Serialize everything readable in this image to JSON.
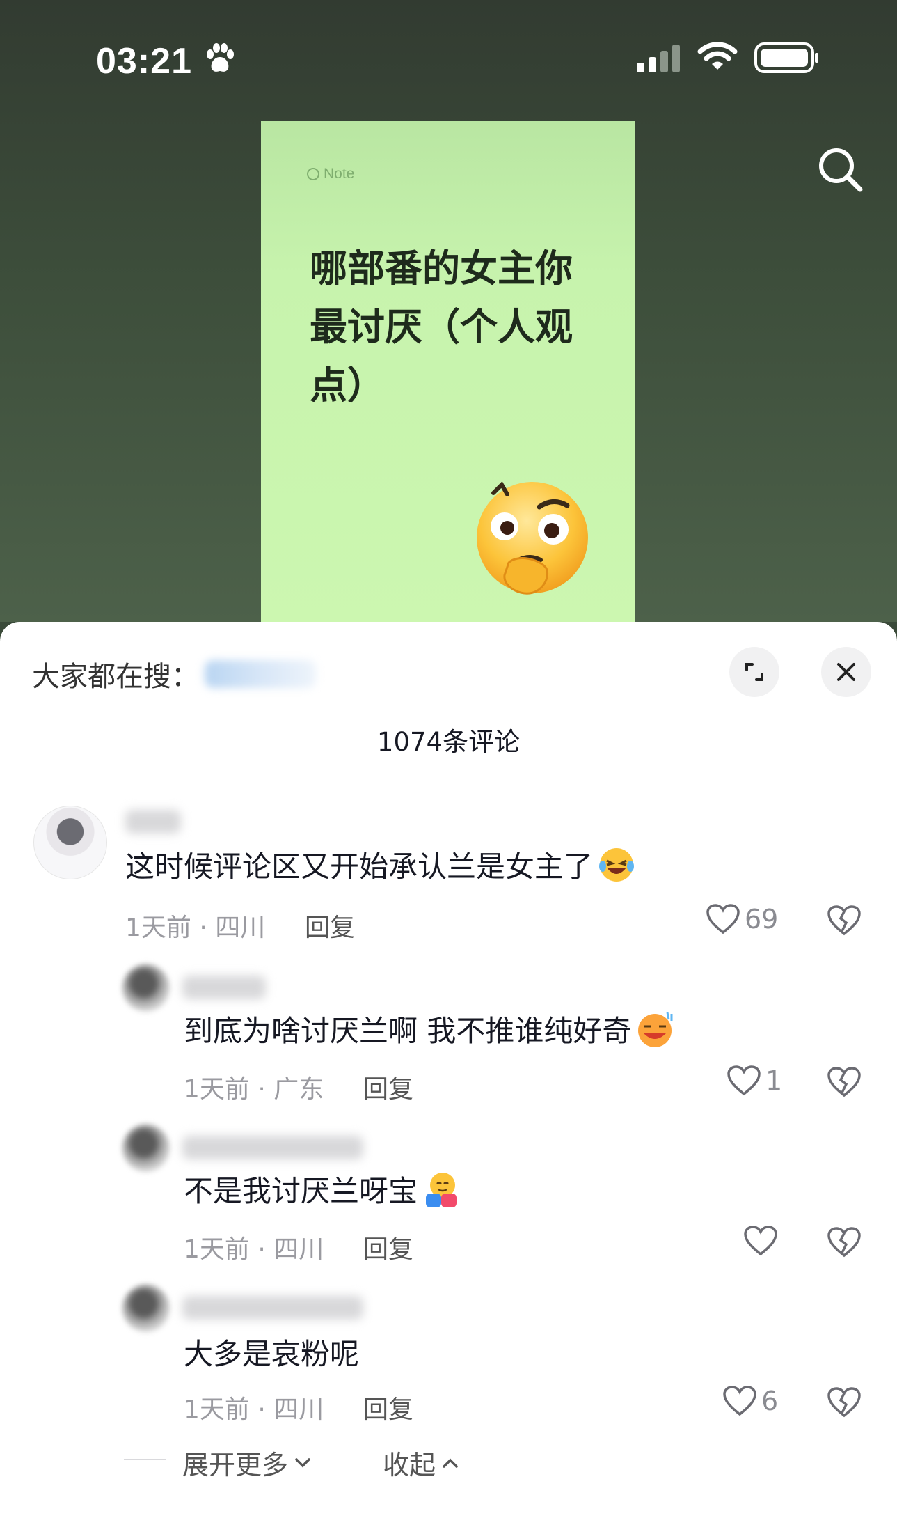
{
  "status_bar": {
    "time": "03:21"
  },
  "note": {
    "tag": "Note",
    "title": "哪部番的女主你最讨厌（个人观点）"
  },
  "sheet": {
    "trending_label": "大家都在搜：",
    "comment_count": "1074条评论"
  },
  "comments": [
    {
      "text": "这时候评论区又开始承认兰是女主了",
      "emoji": "laughing-tears",
      "meta": "1天前 · 四川",
      "reply": "回复",
      "likes": "69"
    },
    {
      "text": "到底为啥讨厌兰啊 我不推谁纯好奇",
      "emoji": "sweat-smile",
      "meta": "1天前 · 广东",
      "reply": "回复",
      "likes": "1"
    },
    {
      "text": "不是我讨厌兰呀宝",
      "emoji": "hug",
      "meta": "1天前 · 四川",
      "reply": "回复",
      "likes": ""
    },
    {
      "text": "大多是哀粉呢",
      "emoji": "",
      "meta": "1天前 · 四川",
      "reply": "回复",
      "likes": "6"
    }
  ],
  "footer": {
    "expand_more": "展开更多",
    "collapse": "收起"
  },
  "colors": {
    "note_bg": "#ccf7b0",
    "sheet_bg": "#ffffff",
    "meta_gray": "#9a9aa0"
  }
}
